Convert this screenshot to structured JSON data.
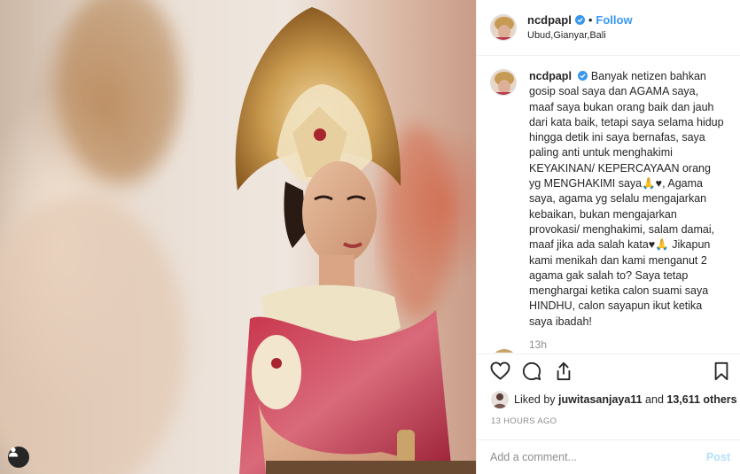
{
  "photo": {
    "alt": "Balinese dancer portrait"
  },
  "header": {
    "username": "ncdpapl",
    "separator": "•",
    "follow_label": "Follow",
    "location": "Ubud,Gianyar,Bali"
  },
  "caption": {
    "username": "ncdpapl",
    "text": "Banyak netizen bahkan gosip soal saya dan AGAMA saya, maaf saya bukan orang baik dan jauh dari kata baik, tetapi saya selama hidup hingga detik ini saya bernafas, saya paling anti untuk menghakimi KEYAKINAN/ KEPERCAYAAN orang yg MENGHAKIMI saya🙏♥, Agama saya, agama yg selalu mengajarkan kebaikan, bukan mengajarkan provokasi/ menghakimi, salam damai, maaf jika ada salah kata♥🙏 Jikapun kami menikah dan kami menganut 2 agama gak salah to? Saya tetap menghargai ketika calon suami saya HINDHU, calon sayapun ikut ketika saya ibadah!",
    "time": "13h"
  },
  "actions": {
    "like": "heart-icon",
    "comment": "comment-icon",
    "share": "share-icon",
    "save": "bookmark-icon"
  },
  "likes": {
    "prefix": "Liked by",
    "user": "juwitasanjaya11",
    "connector": "and",
    "others": "13,611 others"
  },
  "timestamp": "13 HOURS AGO",
  "comment_box": {
    "placeholder": "Add a comment...",
    "post_label": "Post"
  },
  "colors": {
    "accent": "#3897f0",
    "post_disabled": "#b2dffc",
    "muted": "#8e8e8e",
    "text": "#262626",
    "border": "#efefef"
  }
}
